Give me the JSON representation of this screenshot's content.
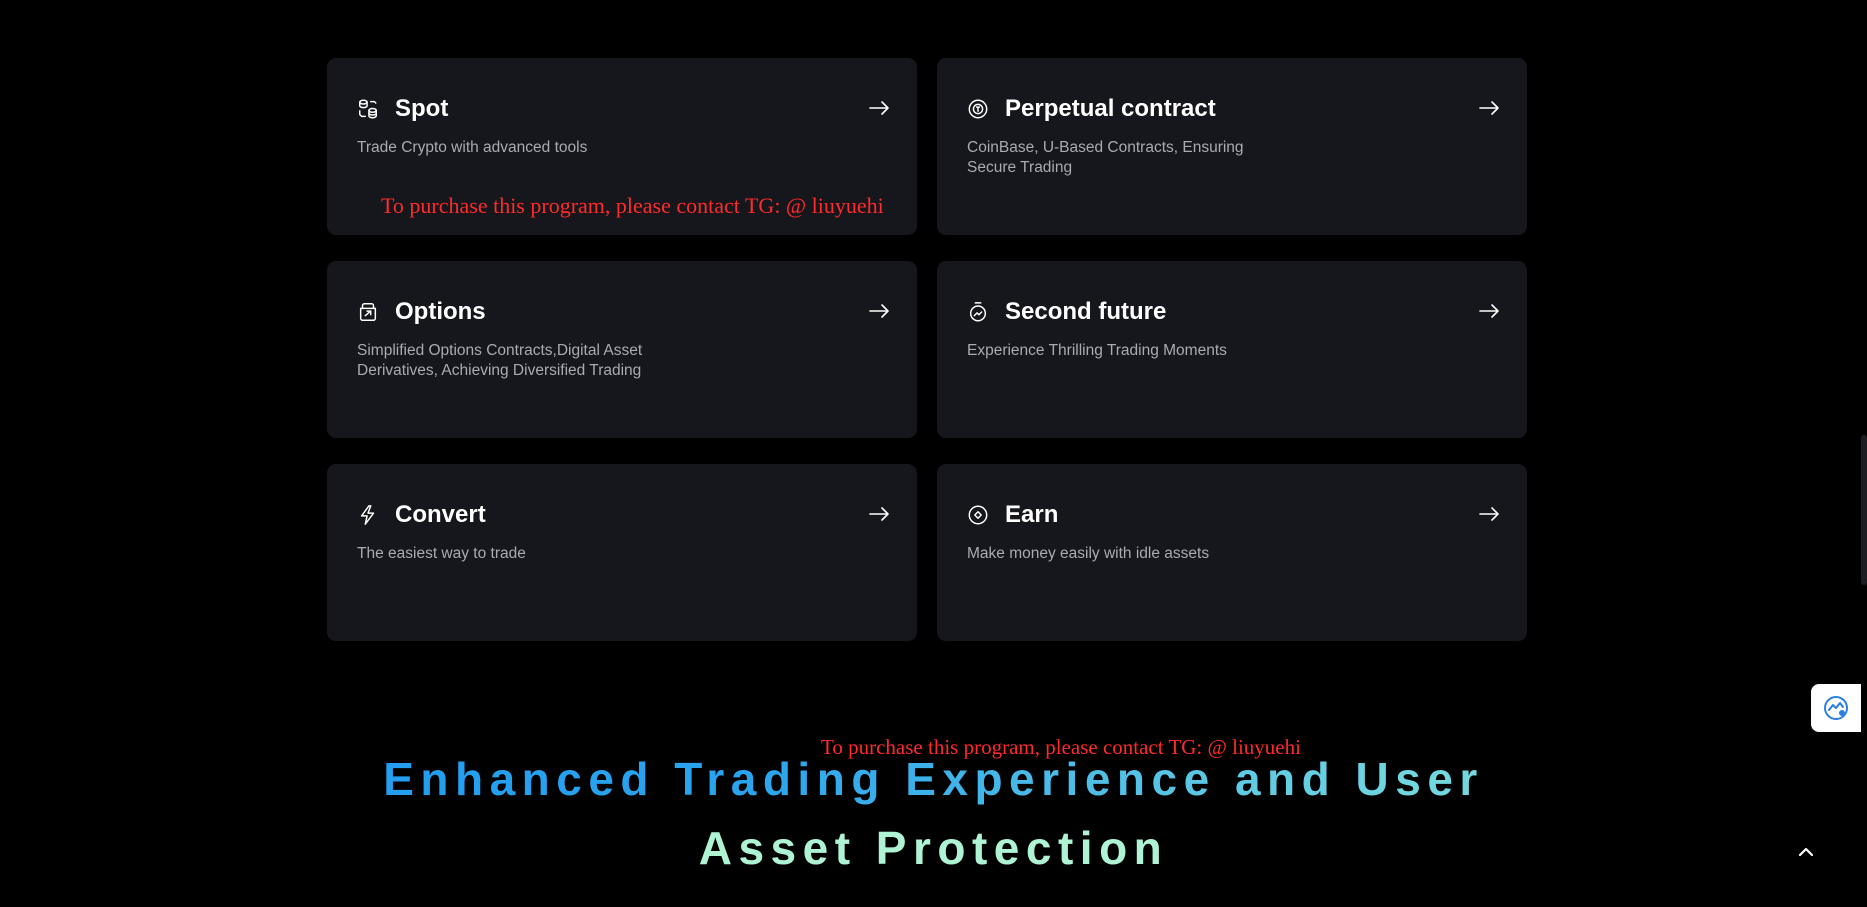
{
  "cards": [
    {
      "title": "Spot",
      "description": "Trade Crypto with advanced tools",
      "icon": "spot-icon"
    },
    {
      "title": "Perpetual contract",
      "description": "CoinBase, U-Based Contracts, Ensuring Secure Trading",
      "icon": "perpetual-icon"
    },
    {
      "title": "Options",
      "description": "Simplified Options Contracts,Digital Asset Derivatives, Achieving Diversified Trading",
      "icon": "options-icon"
    },
    {
      "title": "Second future",
      "description": "Experience Thrilling Trading Moments",
      "icon": "stopwatch-icon"
    },
    {
      "title": "Convert",
      "description": "The easiest way to trade",
      "icon": "lightning-icon"
    },
    {
      "title": "Earn",
      "description": "Make money easily with idle assets",
      "icon": "earn-icon"
    }
  ],
  "watermarks": [
    "To purchase this program, please contact TG: @ liuyuehi",
    "To purchase this program, please contact TG: @ liuyuehi"
  ],
  "headline": {
    "line1": "Enhanced Trading Experience and User",
    "line2": "Asset Protection"
  },
  "colors": {
    "background": "#000000",
    "card": "#16171c",
    "watermark": "#ff2a2a",
    "headline_blue": "#1b98f2",
    "headline_mint": "#aef3d4"
  }
}
